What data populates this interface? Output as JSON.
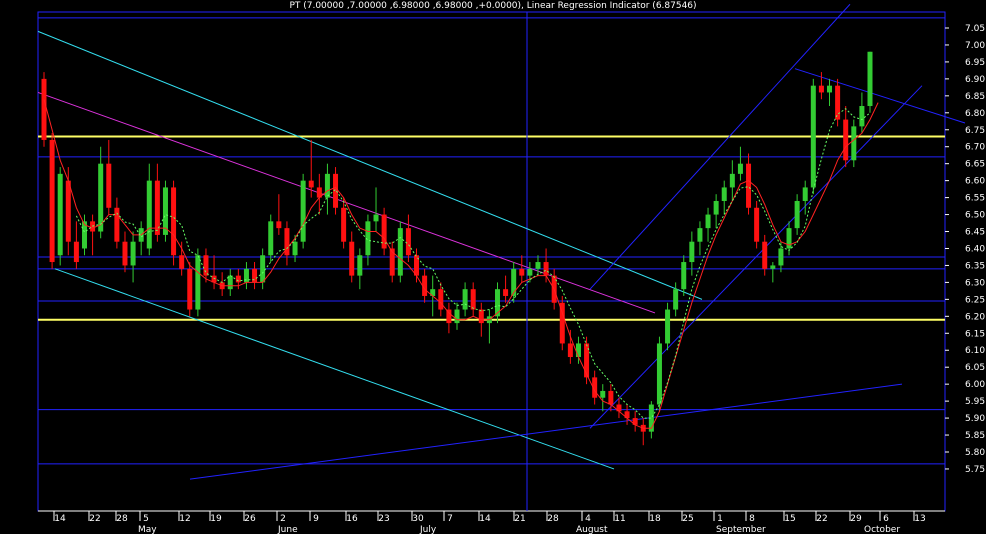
{
  "chart_data": {
    "type": "candlestick",
    "title": "PT (7.00000 ,7.00000 ,6.98000 ,6.98000 ,+0.0000), Linear Regression Indicator (6.87546)",
    "ylim": [
      5.72,
      7.1
    ],
    "y_ticks": [
      "7.05",
      "7.00",
      "6.95",
      "6.90",
      "6.85",
      "6.80",
      "6.75",
      "6.70",
      "6.65",
      "6.60",
      "6.55",
      "6.50",
      "6.45",
      "6.40",
      "6.35",
      "6.30",
      "6.25",
      "6.20",
      "6.15",
      "6.10",
      "6.05",
      "6.00",
      "5.95",
      "5.90",
      "5.85",
      "5.80",
      "5.75"
    ],
    "x_day_labels": [
      "14",
      "22",
      "28",
      "5",
      "12",
      "19",
      "26",
      "2",
      "9",
      "16",
      "23",
      "30",
      "7",
      "14",
      "21",
      "28",
      "4",
      "11",
      "18",
      "25",
      "1",
      "8",
      "15",
      "22",
      "29",
      "6",
      "13"
    ],
    "x_month_labels": [
      "May",
      "June",
      "July",
      "August",
      "September",
      "October"
    ],
    "horizontal_levels": [
      {
        "value": 6.73,
        "color": "#ffff66"
      },
      {
        "value": 6.19,
        "color": "#ffff66"
      },
      {
        "value": 7.08,
        "color": "#2222ff"
      },
      {
        "value": 6.67,
        "color": "#2222ff"
      },
      {
        "value": 6.375,
        "color": "#2222ff"
      },
      {
        "value": 6.34,
        "color": "#2222ff"
      },
      {
        "value": 6.245,
        "color": "#2222ff"
      },
      {
        "value": 5.925,
        "color": "#2222ff"
      },
      {
        "value": 5.765,
        "color": "#2222ff"
      }
    ],
    "colors": {
      "up": "#33cc33",
      "down": "#ff1111",
      "grid": "#2222ff",
      "text": "#ffffff"
    },
    "ohlc": [
      [
        6.9,
        6.92,
        6.7,
        6.72
      ],
      [
        6.72,
        6.74,
        6.34,
        6.36
      ],
      [
        6.38,
        6.64,
        6.35,
        6.62
      ],
      [
        6.6,
        6.64,
        6.38,
        6.42
      ],
      [
        6.42,
        6.48,
        6.34,
        6.36
      ],
      [
        6.4,
        6.5,
        6.38,
        6.48
      ],
      [
        6.48,
        6.5,
        6.38,
        6.45
      ],
      [
        6.45,
        6.7,
        6.43,
        6.65
      ],
      [
        6.65,
        6.72,
        6.5,
        6.52
      ],
      [
        6.52,
        6.55,
        6.4,
        6.42
      ],
      [
        6.42,
        6.45,
        6.33,
        6.35
      ],
      [
        6.35,
        6.45,
        6.3,
        6.42
      ],
      [
        6.42,
        6.48,
        6.38,
        6.46
      ],
      [
        6.4,
        6.65,
        6.38,
        6.6
      ],
      [
        6.6,
        6.65,
        6.42,
        6.44
      ],
      [
        6.44,
        6.6,
        6.42,
        6.58
      ],
      [
        6.58,
        6.6,
        6.35,
        6.38
      ],
      [
        6.38,
        6.42,
        6.32,
        6.34
      ],
      [
        6.34,
        6.36,
        6.2,
        6.22
      ],
      [
        6.22,
        6.4,
        6.2,
        6.38
      ],
      [
        6.38,
        6.4,
        6.3,
        6.32
      ],
      [
        6.32,
        6.38,
        6.28,
        6.3
      ],
      [
        6.3,
        6.33,
        6.26,
        6.28
      ],
      [
        6.28,
        6.34,
        6.26,
        6.32
      ],
      [
        6.32,
        6.34,
        6.28,
        6.3
      ],
      [
        6.3,
        6.36,
        6.28,
        6.34
      ],
      [
        6.34,
        6.36,
        6.28,
        6.3
      ],
      [
        6.3,
        6.4,
        6.28,
        6.38
      ],
      [
        6.38,
        6.5,
        6.36,
        6.48
      ],
      [
        6.48,
        6.56,
        6.44,
        6.46
      ],
      [
        6.46,
        6.48,
        6.35,
        6.38
      ],
      [
        6.38,
        6.44,
        6.36,
        6.42
      ],
      [
        6.42,
        6.62,
        6.4,
        6.6
      ],
      [
        6.6,
        6.72,
        6.55,
        6.58
      ],
      [
        6.58,
        6.62,
        6.5,
        6.55
      ],
      [
        6.55,
        6.65,
        6.5,
        6.62
      ],
      [
        6.62,
        6.64,
        6.5,
        6.52
      ],
      [
        6.52,
        6.55,
        6.4,
        6.42
      ],
      [
        6.42,
        6.45,
        6.3,
        6.32
      ],
      [
        6.32,
        6.4,
        6.28,
        6.38
      ],
      [
        6.38,
        6.5,
        6.35,
        6.48
      ],
      [
        6.48,
        6.58,
        6.45,
        6.5
      ],
      [
        6.5,
        6.52,
        6.38,
        6.4
      ],
      [
        6.4,
        6.42,
        6.3,
        6.32
      ],
      [
        6.32,
        6.48,
        6.3,
        6.46
      ],
      [
        6.46,
        6.5,
        6.36,
        6.38
      ],
      [
        6.38,
        6.4,
        6.3,
        6.32
      ],
      [
        6.32,
        6.34,
        6.24,
        6.26
      ],
      [
        6.26,
        6.32,
        6.2,
        6.28
      ],
      [
        6.28,
        6.3,
        6.2,
        6.22
      ],
      [
        6.22,
        6.24,
        6.15,
        6.18
      ],
      [
        6.18,
        6.24,
        6.16,
        6.22
      ],
      [
        6.22,
        6.3,
        6.2,
        6.28
      ],
      [
        6.28,
        6.3,
        6.2,
        6.22
      ],
      [
        6.22,
        6.24,
        6.14,
        6.18
      ],
      [
        6.18,
        6.22,
        6.12,
        6.2
      ],
      [
        6.2,
        6.3,
        6.18,
        6.28
      ],
      [
        6.28,
        6.32,
        6.24,
        6.26
      ],
      [
        6.26,
        6.36,
        6.24,
        6.34
      ],
      [
        6.34,
        6.38,
        6.3,
        6.32
      ],
      [
        6.32,
        6.36,
        6.3,
        6.34
      ],
      [
        6.34,
        6.38,
        6.32,
        6.36
      ],
      [
        6.36,
        6.4,
        6.3,
        6.32
      ],
      [
        6.32,
        6.34,
        6.22,
        6.24
      ],
      [
        6.24,
        6.26,
        6.1,
        6.12
      ],
      [
        6.12,
        6.16,
        6.06,
        6.08
      ],
      [
        6.08,
        6.14,
        6.06,
        6.12
      ],
      [
        6.12,
        6.14,
        6.0,
        6.02
      ],
      [
        6.02,
        6.04,
        5.94,
        5.96
      ],
      [
        5.96,
        6.0,
        5.92,
        5.98
      ],
      [
        5.98,
        6.0,
        5.92,
        5.94
      ],
      [
        5.94,
        5.96,
        5.9,
        5.92
      ],
      [
        5.92,
        5.94,
        5.88,
        5.9
      ],
      [
        5.9,
        5.92,
        5.86,
        5.88
      ],
      [
        5.88,
        5.9,
        5.82,
        5.86
      ],
      [
        5.86,
        5.95,
        5.84,
        5.94
      ],
      [
        5.94,
        6.14,
        5.92,
        6.12
      ],
      [
        6.12,
        6.24,
        6.1,
        6.22
      ],
      [
        6.22,
        6.3,
        6.2,
        6.28
      ],
      [
        6.28,
        6.38,
        6.26,
        6.36
      ],
      [
        6.36,
        6.45,
        6.32,
        6.42
      ],
      [
        6.42,
        6.48,
        6.38,
        6.46
      ],
      [
        6.46,
        6.52,
        6.42,
        6.5
      ],
      [
        6.5,
        6.56,
        6.46,
        6.54
      ],
      [
        6.54,
        6.6,
        6.5,
        6.58
      ],
      [
        6.58,
        6.66,
        6.54,
        6.62
      ],
      [
        6.62,
        6.7,
        6.6,
        6.65
      ],
      [
        6.65,
        6.68,
        6.5,
        6.52
      ],
      [
        6.52,
        6.54,
        6.4,
        6.42
      ],
      [
        6.42,
        6.44,
        6.32,
        6.34
      ],
      [
        6.34,
        6.36,
        6.3,
        6.35
      ],
      [
        6.35,
        6.42,
        6.33,
        6.4
      ],
      [
        6.4,
        6.48,
        6.38,
        6.46
      ],
      [
        6.46,
        6.56,
        6.44,
        6.54
      ],
      [
        6.54,
        6.6,
        6.5,
        6.58
      ],
      [
        6.58,
        6.9,
        6.56,
        6.88
      ],
      [
        6.88,
        6.92,
        6.84,
        6.86
      ],
      [
        6.86,
        6.9,
        6.82,
        6.88
      ],
      [
        6.88,
        6.9,
        6.76,
        6.78
      ],
      [
        6.78,
        6.82,
        6.64,
        6.66
      ],
      [
        6.66,
        6.78,
        6.64,
        6.76
      ],
      [
        6.76,
        6.86,
        6.74,
        6.82
      ],
      [
        6.82,
        6.98,
        6.8,
        6.98
      ]
    ],
    "linear_regression_indicator": [
      6.84,
      6.75,
      6.66,
      6.6,
      6.52,
      6.47,
      6.46,
      6.47,
      6.5,
      6.5,
      6.47,
      6.44,
      6.44,
      6.46,
      6.46,
      6.46,
      6.44,
      6.4,
      6.35,
      6.33,
      6.31,
      6.3,
      6.29,
      6.29,
      6.29,
      6.3,
      6.3,
      6.3,
      6.33,
      6.37,
      6.4,
      6.43,
      6.47,
      6.52,
      6.55,
      6.57,
      6.58,
      6.55,
      6.5,
      6.46,
      6.45,
      6.45,
      6.43,
      6.39,
      6.37,
      6.35,
      6.32,
      6.28,
      6.26,
      6.24,
      6.21,
      6.19,
      6.19,
      6.2,
      6.19,
      6.19,
      6.21,
      6.23,
      6.27,
      6.3,
      6.31,
      6.32,
      6.32,
      6.28,
      6.21,
      6.14,
      6.08,
      6.03,
      5.98,
      5.95,
      5.94,
      5.92,
      5.9,
      5.88,
      5.87,
      5.87,
      5.92,
      6.0,
      6.08,
      6.16,
      6.24,
      6.31,
      6.38,
      6.44,
      6.49,
      6.54,
      6.59,
      6.6,
      6.58,
      6.53,
      6.47,
      6.42,
      6.41,
      6.42,
      6.45,
      6.5,
      6.55,
      6.6,
      6.66,
      6.7,
      6.72,
      6.74,
      6.78,
      6.83
    ]
  }
}
